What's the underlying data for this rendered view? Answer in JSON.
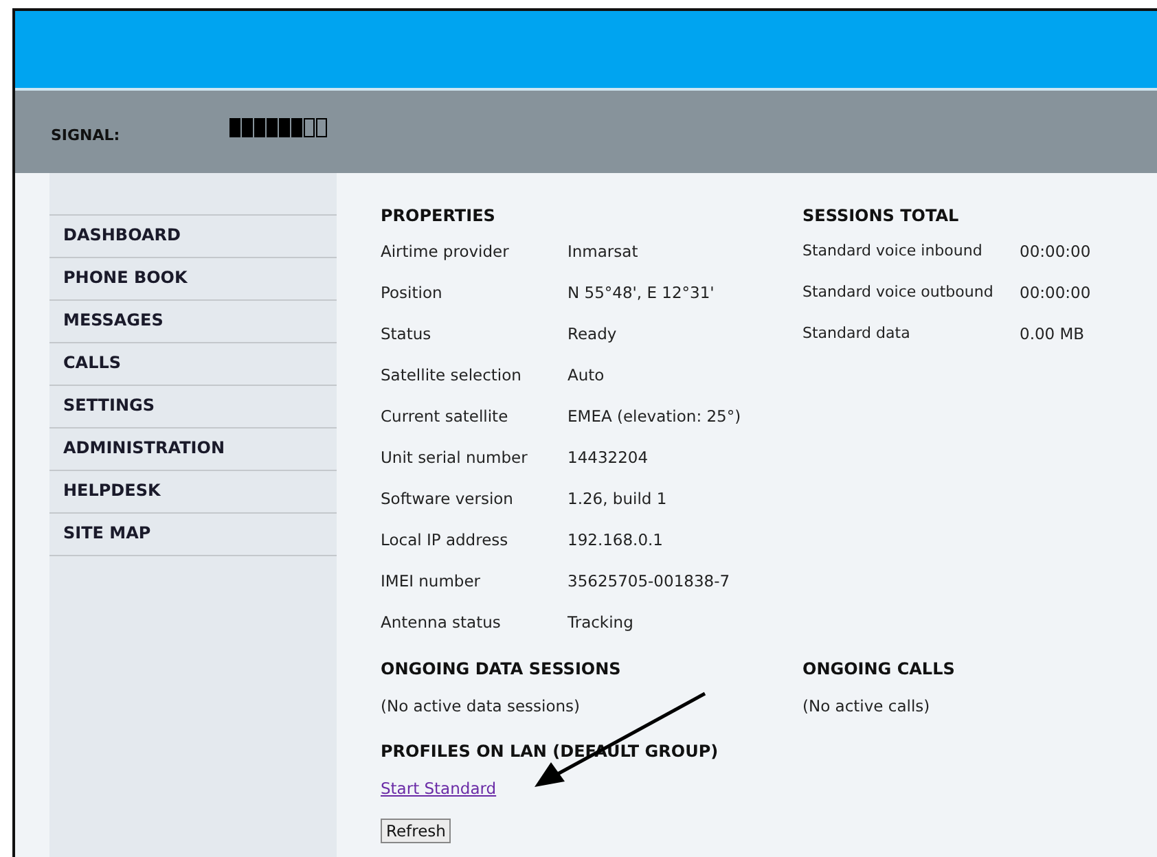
{
  "signal": {
    "label": "SIGNAL:"
  },
  "menu": [
    {
      "label": "DASHBOARD"
    },
    {
      "label": "PHONE BOOK"
    },
    {
      "label": "MESSAGES"
    },
    {
      "label": "CALLS"
    },
    {
      "label": "SETTINGS"
    },
    {
      "label": "ADMINISTRATION"
    },
    {
      "label": "HELPDESK"
    },
    {
      "label": "SITE MAP"
    }
  ],
  "properties": {
    "title": "PROPERTIES",
    "rows": [
      {
        "label": "Airtime provider",
        "value": "Inmarsat"
      },
      {
        "label": "Position",
        "value": "N 55°48', E 12°31'"
      },
      {
        "label": "Status",
        "value": "Ready"
      },
      {
        "label": "Satellite selection",
        "value": "Auto"
      },
      {
        "label": "Current satellite",
        "value": "EMEA (elevation: 25°)"
      },
      {
        "label": "Unit serial number",
        "value": "14432204"
      },
      {
        "label": "Software version",
        "value": "1.26, build 1"
      },
      {
        "label": "Local IP address",
        "value": "192.168.0.1"
      },
      {
        "label": "IMEI number",
        "value": "35625705-001838-7"
      },
      {
        "label": "Antenna status",
        "value": "Tracking"
      }
    ]
  },
  "sessions_total": {
    "title": "SESSIONS TOTAL",
    "rows": [
      {
        "label": "Standard voice inbound",
        "value": "00:00:00"
      },
      {
        "label": "Standard voice outbound",
        "value": "00:00:00"
      },
      {
        "label": "Standard data",
        "value": "0.00 MB"
      }
    ]
  },
  "ongoing_data": {
    "title": "ONGOING DATA SESSIONS",
    "text": "(No active data sessions)"
  },
  "ongoing_calls": {
    "title": "ONGOING CALLS",
    "text": "(No active calls)"
  },
  "profiles": {
    "title": "PROFILES ON LAN (DEFAULT GROUP)",
    "link": "Start Standard"
  },
  "refresh_button": "Refresh"
}
